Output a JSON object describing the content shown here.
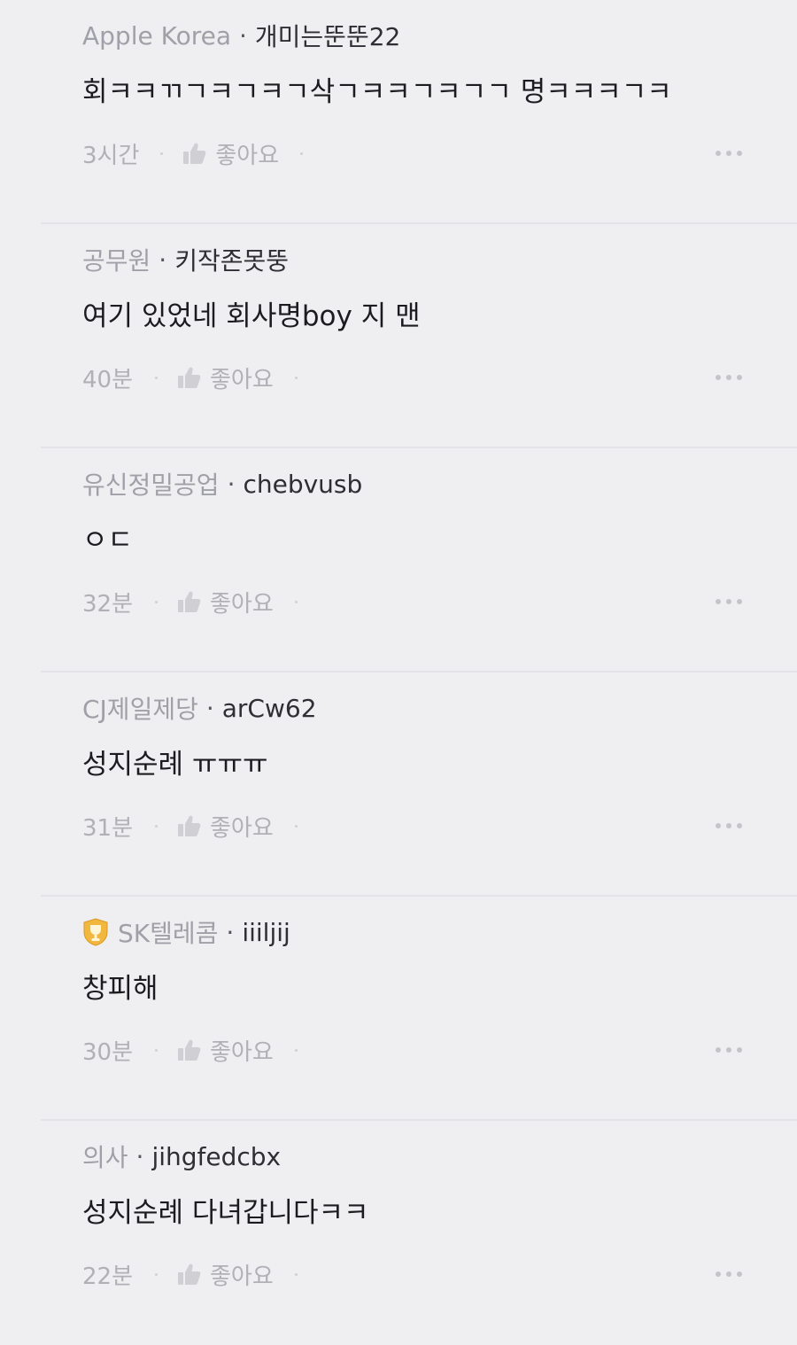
{
  "colors": {
    "background": "#efeff1",
    "company": "#a0a0a8",
    "nickname": "#2e2e34",
    "body": "#1c1c20",
    "muted": "#b0b0b6",
    "badge_gold": "#f1b73e"
  },
  "comments": [
    {
      "company": "Apple Korea",
      "separator": "·",
      "nickname": "개미는뚠뚠22",
      "text": "회ㅋㅋㄲㄱㅋㄱㅋㄱ삭ㄱㅋㅋㄱㅋㄱㄱ 명ㅋㅋㅋㄱㅋ",
      "time": "3시간",
      "like_label": "좋아요",
      "like_icon": "thumbs-up-icon",
      "more_icon": "more-icon"
    },
    {
      "company": "공무원",
      "separator": "·",
      "nickname": "키작존못뚱",
      "text": "여기 있었네 회사명boy 지 맨",
      "time": "40분",
      "like_label": "좋아요",
      "like_icon": "thumbs-up-icon",
      "more_icon": "more-icon"
    },
    {
      "company": "유신정밀공업",
      "separator": "·",
      "nickname": "chebvusb",
      "text": "ㅇㄷ",
      "time": "32분",
      "like_label": "좋아요",
      "like_icon": "thumbs-up-icon",
      "more_icon": "more-icon"
    },
    {
      "company": "CJ제일제당",
      "separator": "·",
      "nickname": "arCw62",
      "text": "성지순례 ㅠㅠㅠ",
      "time": "31분",
      "like_label": "좋아요",
      "like_icon": "thumbs-up-icon",
      "more_icon": "more-icon"
    },
    {
      "company": "SK텔레콤",
      "separator": "·",
      "nickname": "iiiljij",
      "text": "창피해",
      "time": "30분",
      "like_label": "좋아요",
      "like_icon": "thumbs-up-icon",
      "more_icon": "more-icon",
      "badge_icon": "trophy-badge-icon"
    },
    {
      "company": "의사",
      "separator": "·",
      "nickname": "jihgfedcbx",
      "text": "성지순례 다녀갑니다ㅋㅋ",
      "time": "22분",
      "like_label": "좋아요",
      "like_icon": "thumbs-up-icon",
      "more_icon": "more-icon"
    }
  ]
}
